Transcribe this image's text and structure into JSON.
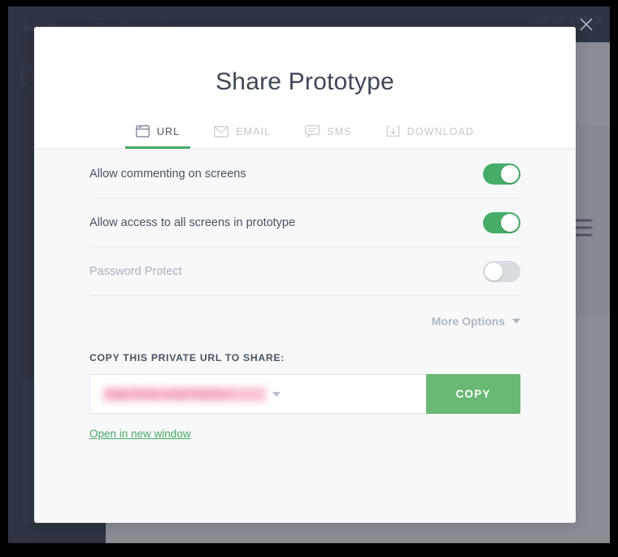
{
  "background": {
    "nav_items": [
      "Activity",
      "People",
      "Learn"
    ],
    "upgrade_label": "UPGRADE N",
    "heading_fragment": "typ"
  },
  "modal": {
    "title": "Share Prototype",
    "close_icon": "close-icon",
    "tabs": [
      {
        "label": "URL",
        "icon": "browser-window-icon",
        "active": true
      },
      {
        "label": "EMAIL",
        "icon": "envelope-icon",
        "active": false
      },
      {
        "label": "SMS",
        "icon": "speech-bubble-icon",
        "active": false
      },
      {
        "label": "DOWNLOAD",
        "icon": "download-icon",
        "active": false
      }
    ],
    "options": [
      {
        "label": "Allow commenting on screens",
        "state": "on",
        "disabled": false
      },
      {
        "label": "Allow access to all screens in prototype",
        "state": "on",
        "disabled": false
      },
      {
        "label": "Password Protect",
        "state": "off",
        "disabled": true
      }
    ],
    "more_options_label": "More Options",
    "url_section": {
      "label": "COPY THIS PRIVATE URL TO SHARE:",
      "value": "https://invis.io/N27P6ZZZJ",
      "placeholder": "https://",
      "copy_button_label": "COPY",
      "open_link_label": "Open in new window"
    }
  },
  "colors": {
    "accent_green": "#4aa866",
    "toggle_on": "#46ad68",
    "toggle_off": "#d8dce1",
    "copy_button": "#69b873",
    "app_chrome": "#343b48",
    "modal_body": "#f7f8fa",
    "modal_header": "#ffffff",
    "text_primary": "#4a5362",
    "text_muted": "#aeb5bf"
  }
}
